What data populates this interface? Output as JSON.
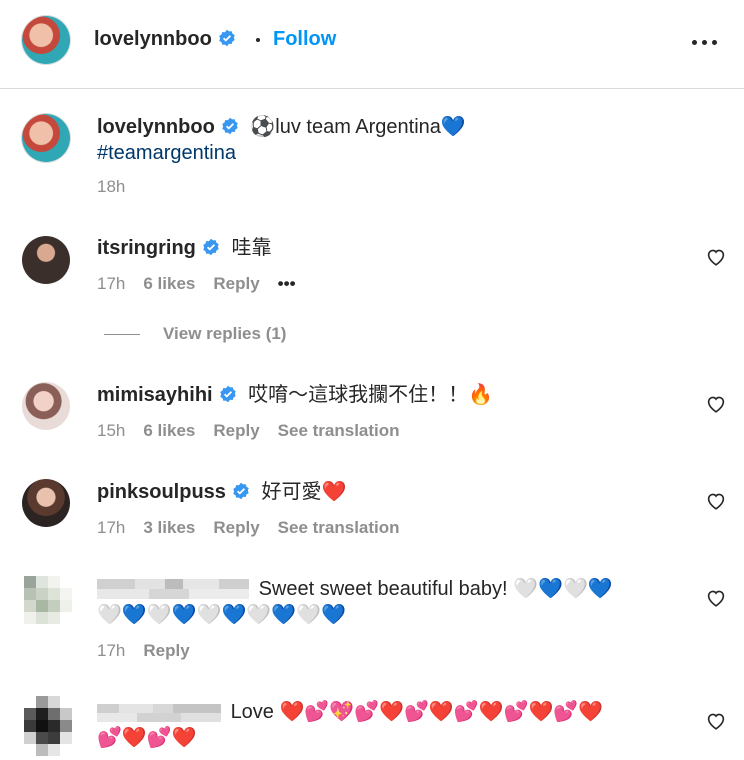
{
  "header": {
    "username": "lovelynnboo",
    "follow_label": "Follow"
  },
  "caption": {
    "username": "lovelynnboo",
    "text": "⚽luv team Argentina💙",
    "hashtag": "#teamargentina",
    "time": "18h"
  },
  "comments": [
    {
      "username": "itsringring",
      "text": "哇靠",
      "time": "17h",
      "likes": "6 likes",
      "reply": "Reply",
      "more": "•••"
    },
    {
      "username": "mimisayhihi",
      "text": "哎唷～這球我攔不住！！🔥",
      "time": "15h",
      "likes": "6 likes",
      "reply": "Reply",
      "translate": "See translation"
    },
    {
      "username": "pinksoulpuss",
      "text": "好可愛❤️",
      "time": "17h",
      "likes": "3 likes",
      "reply": "Reply",
      "translate": "See translation"
    },
    {
      "username_hidden": "blurred",
      "text_line1": "Sweet sweet beautiful baby! 🤍💙🤍💙",
      "text_line2": "🤍💙🤍💙🤍💙🤍💙🤍💙",
      "time": "17h",
      "reply": "Reply"
    },
    {
      "username_hidden": "blurred",
      "text_line1": "Love ❤️💕💖💕❤️💕❤️💕❤️💕❤️💕❤️",
      "text_line2": "💕❤️💕❤️"
    }
  ],
  "view_replies": "View replies (1)",
  "icons": {
    "verified": "verified-badge-icon",
    "more": "more-options-icon",
    "heart": "heart-outline-icon"
  },
  "colors": {
    "link": "#0095f6",
    "hashtag": "#00376b",
    "verified": "#3897f0",
    "muted": "#8e8e8e"
  }
}
